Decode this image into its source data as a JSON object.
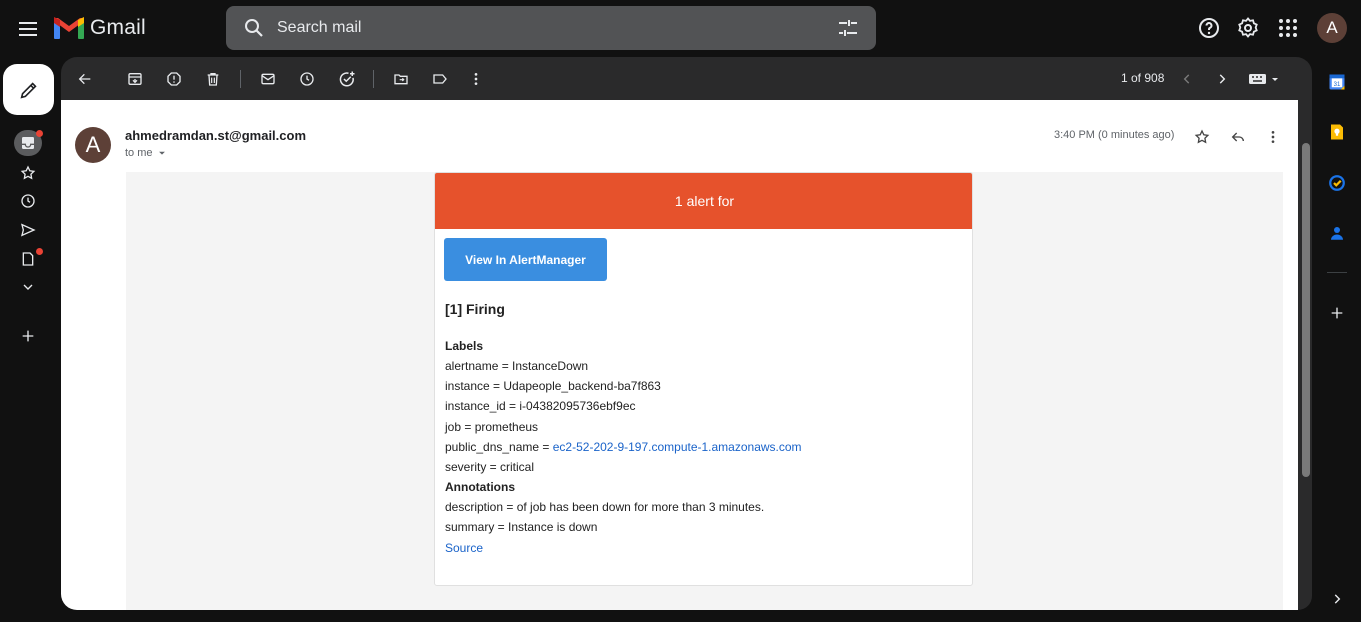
{
  "app": {
    "name": "Gmail"
  },
  "search": {
    "placeholder": "Search mail"
  },
  "account": {
    "initial": "A"
  },
  "toolbar": {
    "page_count": "1 of 908"
  },
  "email": {
    "sender": "ahmedramdan.st@gmail.com",
    "recipient": "to me",
    "timestamp": "3:40 PM (0 minutes ago)",
    "avatar_initial": "A"
  },
  "alert": {
    "header": "1 alert for",
    "button_label": "View In AlertManager",
    "firing_title": "[1] Firing",
    "labels_heading": "Labels",
    "labels": {
      "alertname": "alertname = InstanceDown",
      "instance": "instance = Udapeople_backend-ba7f863",
      "instance_id": "instance_id = i-04382095736ebf9ec",
      "job": "job = prometheus",
      "public_dns_prefix": "public_dns_name = ",
      "public_dns_link": "ec2-52-202-9-197.compute-1.amazonaws.com",
      "severity": "severity = critical"
    },
    "annotations_heading": "Annotations",
    "annotations": {
      "description": "description = of job has been down for more than 3 minutes.",
      "summary": "summary = Instance is down"
    },
    "source_link": "Source"
  },
  "colors": {
    "alert_header": "#e6522c",
    "alert_button": "#3a8ee0",
    "link": "#1a63c9",
    "avatar": "#5d4037"
  }
}
